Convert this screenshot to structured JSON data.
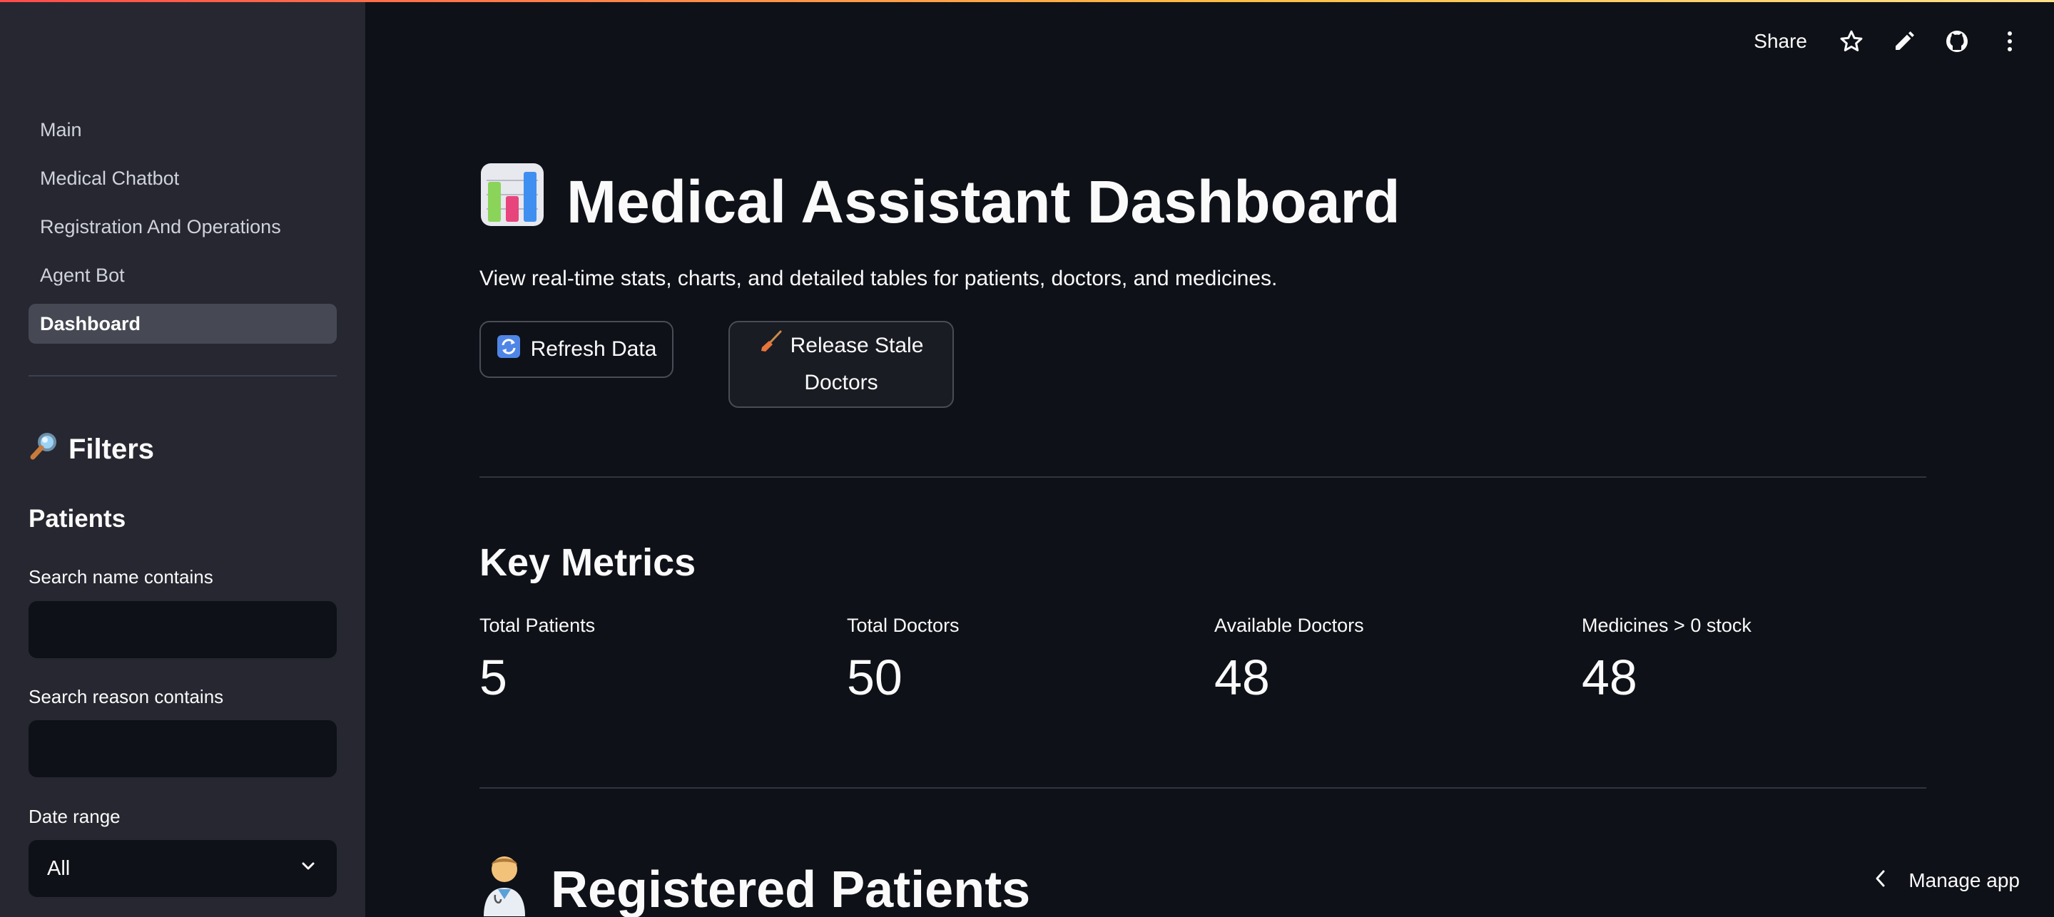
{
  "sidebar": {
    "nav": [
      "Main",
      "Medical Chatbot",
      "Registration And Operations",
      "Agent Bot",
      "Dashboard"
    ],
    "active_nav": "Dashboard",
    "filters_title": "Filters",
    "filters_icon": "magnifier-icon",
    "patients_heading": "Patients",
    "search_name_label": "Search name contains",
    "search_name_value": "",
    "search_reason_label": "Search reason contains",
    "search_reason_value": "",
    "date_range_label": "Date range",
    "date_range_value": "All"
  },
  "toolbar": {
    "share_label": "Share",
    "icons": [
      "star-icon",
      "pencil-icon",
      "github-icon",
      "more-vertical-icon"
    ]
  },
  "main": {
    "title": "Medical Assistant Dashboard",
    "title_icon": "bar-chart-icon",
    "subtitle": "View real-time stats, charts, and detailed tables for patients, doctors, and medicines.",
    "refresh_label": "Refresh Data",
    "release_label": "Release Stale Doctors",
    "key_metrics_heading": "Key Metrics",
    "metrics": [
      {
        "label": "Total Patients",
        "value": "5"
      },
      {
        "label": "Total Doctors",
        "value": "50"
      },
      {
        "label": "Available Doctors",
        "value": "48"
      },
      {
        "label": "Medicines > 0 stock",
        "value": "48"
      }
    ],
    "registered_heading": "Registered Patients",
    "registered_icon": "doctor-icon"
  },
  "footer": {
    "manage_label": "Manage app"
  },
  "colors": {
    "background": "#0e1117",
    "sidebar": "#262730",
    "active_nav": "#464854",
    "text": "#fafafa"
  }
}
